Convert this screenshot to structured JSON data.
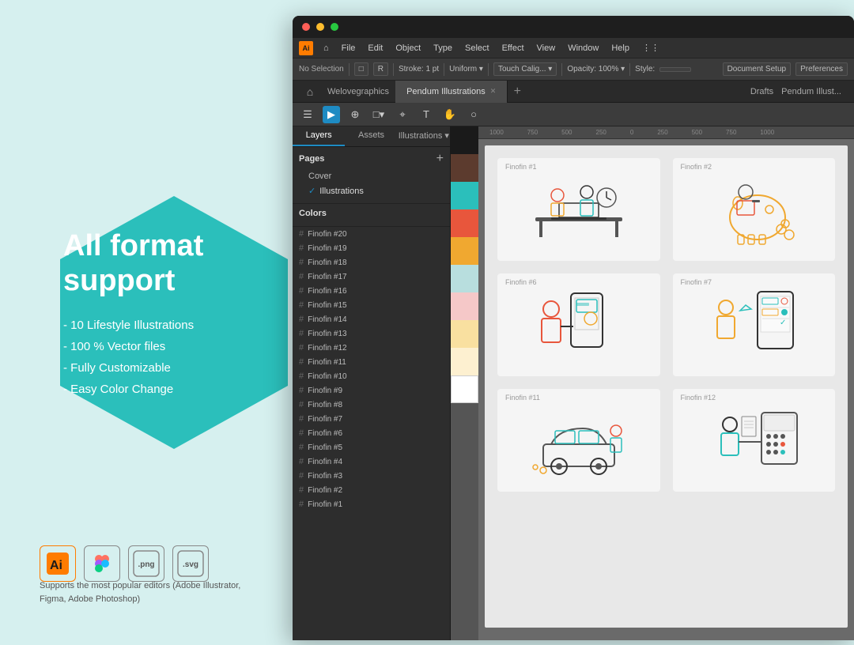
{
  "left_panel": {
    "title_line1": "All format",
    "title_line2": "support",
    "features": [
      "- 10 Lifestyle Illustrations",
      "- 100 % Vector files",
      "- Fully Customizable",
      "- Easy Color Change"
    ],
    "editors_caption": "Supports the most popular editors (Adobe Illustrator, Figma, Adobe Photoshop)",
    "editor_icons": [
      "Ai",
      "F",
      ".png",
      ".svg"
    ]
  },
  "ai_window": {
    "title_bar_dots": [
      "red",
      "yellow",
      "green"
    ],
    "menu_items": [
      "Ai",
      "⌂",
      "File",
      "Edit",
      "Object",
      "Type",
      "Select",
      "Effect",
      "View",
      "Window",
      "Help",
      "⋮⋮"
    ],
    "toolbar_items": [
      "No Selection",
      "Stroke: 1 pt",
      "Uniform",
      "Touch Calig...",
      "Opacity: 100%",
      "Style:"
    ],
    "right_toolbar": [
      "Document Setup",
      "Preferences"
    ],
    "app_name": "Welovegraphics",
    "tab_name": "Pendum Illustrations",
    "tools_bar_icons": [
      "☰",
      "▶",
      "⊕",
      "⬜",
      "⌖",
      "T",
      "✋",
      "○"
    ],
    "right_tabs": [
      "Drafts",
      "Pendum Illust..."
    ],
    "panel_tabs": [
      "Layers",
      "Assets",
      "Illustrations"
    ],
    "pages_section": {
      "title": "Pages",
      "pages": [
        "Cover",
        "Illustrations"
      ]
    },
    "colors_section": {
      "title": "Colors"
    },
    "layers": [
      "Finofin #20",
      "Finofin #19",
      "Finofin #18",
      "Finofin #17",
      "Finofin #16",
      "Finofin #15",
      "Finofin #14",
      "Finofin #13",
      "Finofin #12",
      "Finofin #11",
      "Finofin #10",
      "Finofin #9",
      "Finofin #8",
      "Finofin #7",
      "Finofin #6",
      "Finofin #5",
      "Finofin #4",
      "Finofin #3",
      "Finofin #2",
      "Finofin #1"
    ],
    "illustration_labels": [
      "Finofin #1",
      "Finofin #2",
      "Finofin #6",
      "Finofin #7",
      "Finofin #11",
      "Finofin #12"
    ],
    "color_swatches": [
      "#1a1a1a",
      "#5c3b2e",
      "#2bbfbb",
      "#e8563c",
      "#f0a830",
      "#b8dede",
      "#f5c8c8",
      "#f9e0a0",
      "#fdf0d0",
      "#ffffff"
    ]
  },
  "colors": {
    "background": "#d6f0ef",
    "hexagon": "#2bbfbb",
    "text_white": "#ffffff",
    "text_dark": "#555555",
    "accent": "#1e8bc3"
  }
}
